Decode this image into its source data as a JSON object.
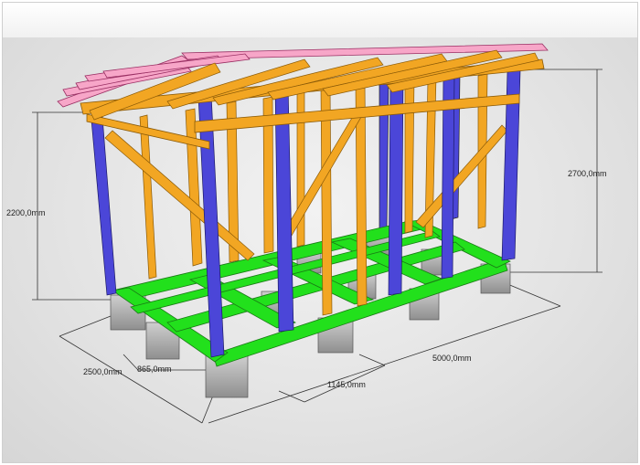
{
  "dimensions": {
    "height_front": "2200,0mm",
    "height_back": "2700,0mm",
    "width": "2500,0mm",
    "length": "5000,0mm",
    "post_spacing": "865,0mm",
    "beam_spacing": "1145,0mm"
  },
  "colors": {
    "post": "#4b46d8",
    "stud": "#f2a623",
    "floor": "#22e01c",
    "rafter": "#f7a6c8",
    "block": "#a9a9a9",
    "dim_line": "#333333"
  }
}
